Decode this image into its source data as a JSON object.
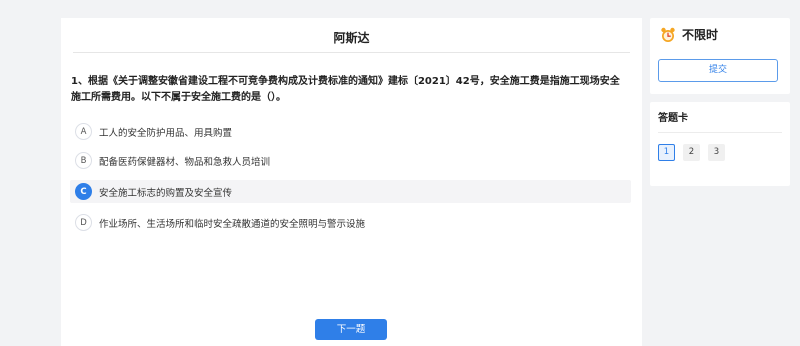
{
  "exam": {
    "title": "阿斯达"
  },
  "question": {
    "text": "1、根据《关于调整安徽省建设工程不可竞争费构成及计费标准的通知》建标〔2021〕42号，安全施工费是指施工现场安全施工所需费用。以下不属于安全施工费的是（）。",
    "options": [
      {
        "letter": "A",
        "text": "工人的安全防护用品、用具购置"
      },
      {
        "letter": "B",
        "text": "配备医药保健器材、物品和急救人员培训"
      },
      {
        "letter": "C",
        "text": "安全施工标志的购置及安全宣传"
      },
      {
        "letter": "D",
        "text": "作业场所、生活场所和临时安全疏散通道的安全照明与警示设施"
      }
    ],
    "selected": "C"
  },
  "buttons": {
    "next": "下一题",
    "submit": "提交"
  },
  "timer": {
    "label": "不限时",
    "icon": "alarm-clock-icon"
  },
  "answer_card": {
    "title": "答题卡",
    "numbers": [
      "1",
      "2",
      "3"
    ],
    "current": "1"
  },
  "colors": {
    "accent": "#2f7fe8",
    "timer_icon": "#f5a623"
  }
}
